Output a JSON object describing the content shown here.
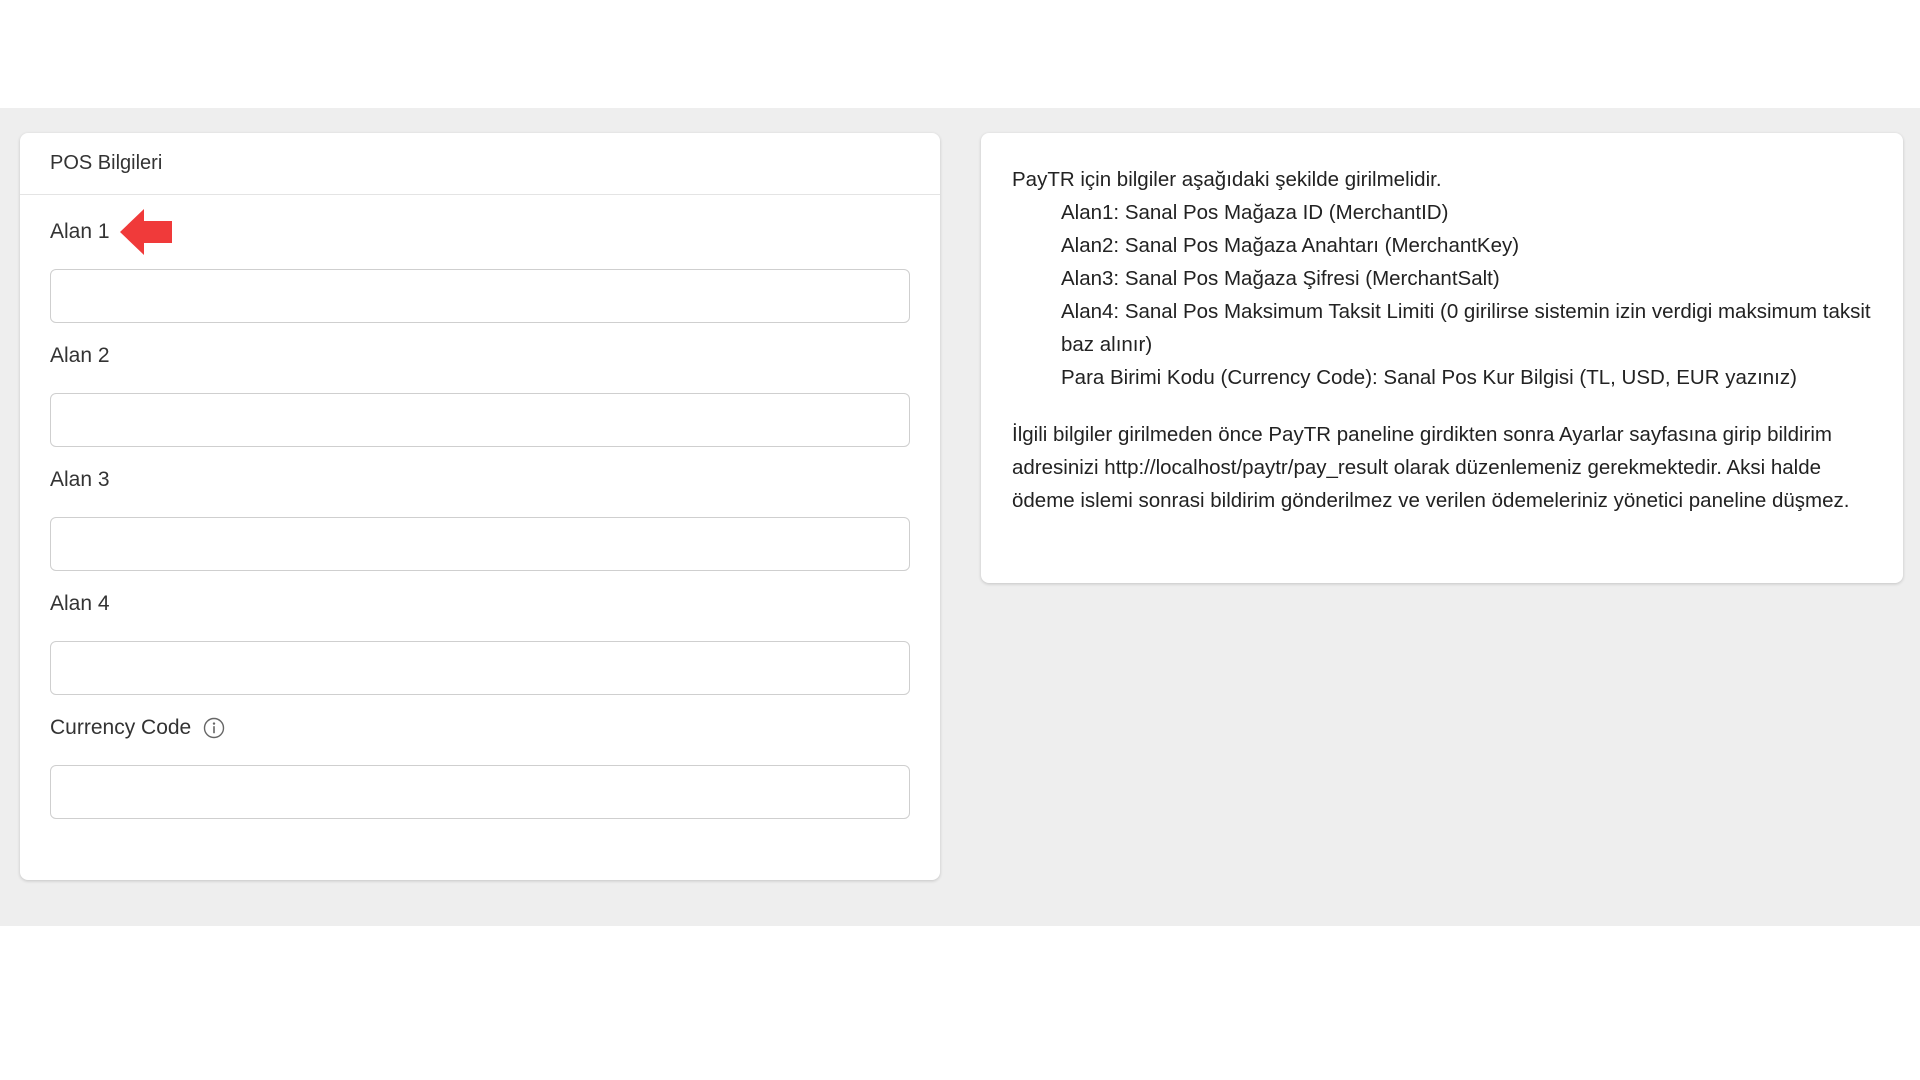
{
  "pos_panel": {
    "title": "POS Bilgileri",
    "fields": [
      {
        "label": "Alan 1",
        "value": "",
        "placeholder": ""
      },
      {
        "label": "Alan 2",
        "value": "",
        "placeholder": ""
      },
      {
        "label": "Alan 3",
        "value": "",
        "placeholder": ""
      },
      {
        "label": "Alan 4",
        "value": "",
        "placeholder": ""
      },
      {
        "label": "Currency Code",
        "value": "",
        "placeholder": ""
      }
    ],
    "arrow_color": "#f03a3a",
    "icons": {
      "arrow": "left-arrow-icon",
      "info": "info-icon"
    }
  },
  "info_panel": {
    "intro": "PayTR için bilgiler aşağıdaki şekilde girilmelidir.",
    "lines": [
      "Alan1: Sanal Pos Mağaza ID (MerchantID)",
      "Alan2: Sanal Pos Mağaza Anahtarı (MerchantKey)",
      "Alan3: Sanal Pos Mağaza Şifresi (MerchantSalt)",
      "Alan4: Sanal Pos Maksimum Taksit Limiti (0 girilirse sistemin izin verdigi maksimum taksit baz alınır)",
      "Para Birimi Kodu (Currency Code): Sanal Pos Kur Bilgisi (TL, USD, EUR yazınız)"
    ],
    "note": "İlgili bilgiler girilmeden önce PayTR paneline girdikten sonra Ayarlar sayfasına girip bildirim adresinizi http://localhost/paytr/pay_result olarak düzenlemeniz gerekmektedir. Aksi halde ödeme islemi sonrasi bildirim gönderilmez ve verilen ödemeleriniz yönetici paneline düşmez."
  }
}
